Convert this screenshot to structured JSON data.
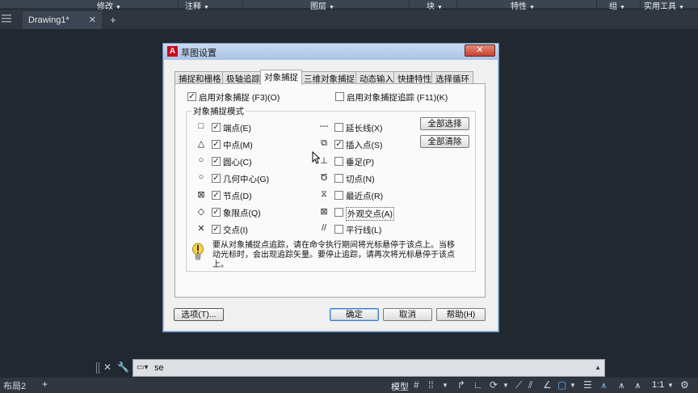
{
  "ribbon": {
    "panels": [
      {
        "label": "修改"
      },
      {
        "label": "注释"
      },
      {
        "label": "图层"
      },
      {
        "label": "块"
      },
      {
        "label": "特性"
      },
      {
        "label": "组"
      },
      {
        "label": "实用工具"
      }
    ]
  },
  "file_tab": {
    "label": "Drawing1*",
    "close": "✕",
    "plus": "+"
  },
  "dialog": {
    "title": "草图设置",
    "close": "✕",
    "app_icon": "A",
    "tabs": [
      "捕捉和栅格",
      "极轴追踪",
      "对象捕捉",
      "三维对象捕捉",
      "动态输入",
      "快捷特性",
      "选择循环"
    ],
    "active_tab": "对象捕捉",
    "enable_osnap": {
      "label": "启用对象捕捉 (F3)(O)",
      "checked": true
    },
    "enable_tracking": {
      "label": "启用对象捕捉追踪 (F11)(K)",
      "checked": false
    },
    "group_label": "对象捕捉模式",
    "left_modes": [
      {
        "symbol": "□",
        "label": "端点(E)",
        "checked": true
      },
      {
        "symbol": "△",
        "label": "中点(M)",
        "checked": true
      },
      {
        "symbol": "○",
        "label": "圆心(C)",
        "checked": true
      },
      {
        "symbol": "○",
        "label": "几何中心(G)",
        "checked": true
      },
      {
        "symbol": "⊠",
        "label": "节点(D)",
        "checked": true
      },
      {
        "symbol": "◇",
        "label": "象限点(Q)",
        "checked": true
      },
      {
        "symbol": "✕",
        "label": "交点(I)",
        "checked": true
      }
    ],
    "right_modes": [
      {
        "symbol": "---",
        "label": "延长线(X)",
        "checked": false
      },
      {
        "symbol": "⧉",
        "label": "插入点(S)",
        "checked": true
      },
      {
        "symbol": "⊥",
        "label": "垂足(P)",
        "checked": false
      },
      {
        "symbol": "Ծ",
        "label": "切点(N)",
        "checked": false
      },
      {
        "symbol": "⧖",
        "label": "最近点(R)",
        "checked": false
      },
      {
        "symbol": "⊠",
        "label": "外观交点(A)",
        "checked": false
      },
      {
        "symbol": "//",
        "label": "平行线(L)",
        "checked": false
      }
    ],
    "select_all": "全部选择",
    "clear_all": "全部清除",
    "tip": "要从对象捕捉点追踪，请在命令执行期间将光标悬停于该点上。当移动光标时，会出现追踪矢量。要停止追踪，请再次将光标悬停于该点上。",
    "options_button": "选项(T)...",
    "ok_button": "确定",
    "cancel_button": "取消",
    "help_button": "帮助(H)"
  },
  "command_line": {
    "value": "se"
  },
  "status_bar": {
    "layout_tab": "布局2",
    "layout_plus": "+",
    "model": "模型",
    "scale": "1:1"
  },
  "colors": {
    "accent": "#6fb3ff",
    "canvas": "#212830",
    "dialog": "#f0f0f0"
  }
}
